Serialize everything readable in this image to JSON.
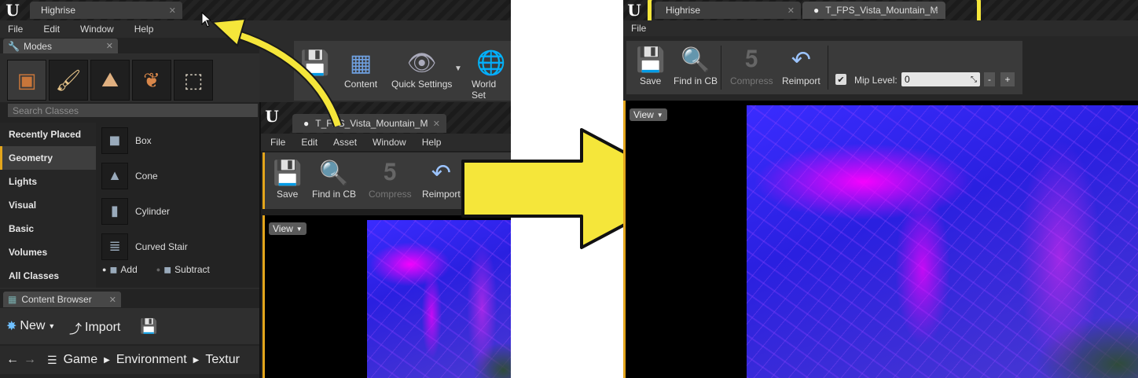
{
  "left_window": {
    "title_tab": "Highrise",
    "menu": [
      "File",
      "Edit",
      "Window",
      "Help"
    ],
    "modes_panel": {
      "tab_label": "Modes",
      "mode_icons": [
        "place-mode-icon",
        "paint-mode-icon",
        "landscape-mode-icon",
        "foliage-mode-icon",
        "geometry-edit-mode-icon"
      ],
      "search_placeholder": "Search Classes",
      "categories": [
        "Recently Placed",
        "Geometry",
        "Lights",
        "Visual",
        "Basic",
        "Volumes",
        "All Classes"
      ],
      "selected_category": "Geometry",
      "items": [
        "Box",
        "Cone",
        "Cylinder",
        "Curved Stair"
      ],
      "brush_add": "Add",
      "brush_subtract": "Subtract"
    },
    "main_toolbar": {
      "buttons": [
        "S",
        "Content",
        "Quick Settings",
        "World Set"
      ]
    },
    "content_browser": {
      "tab_label": "Content Browser",
      "new_label": "New",
      "import_label": "Import",
      "breadcrumb": [
        "Game",
        "Environment",
        "Textur"
      ]
    },
    "texture_editor": {
      "tab_label": "T_FPS_Vista_Mountain_M",
      "menu": [
        "File",
        "Edit",
        "Asset",
        "Window",
        "Help"
      ],
      "toolbar": [
        "Save",
        "Find in CB",
        "Compress",
        "Reimport"
      ],
      "view_label": "View"
    }
  },
  "right_window": {
    "tabs": [
      "Highrise",
      "T_FPS_Vista_Mountain_M"
    ],
    "menu_visible": "File",
    "toolbar": [
      "Save",
      "Find in CB",
      "Compress",
      "Reimport"
    ],
    "mip_label": "Mip Level:",
    "mip_value": "0",
    "mip_minus": "-",
    "mip_plus": "+",
    "view_label": "View"
  },
  "colors": {
    "highlight_yellow": "#f5e63a",
    "ue_dark": "#2b2b2b",
    "selected_accent": "#e3a51c"
  }
}
